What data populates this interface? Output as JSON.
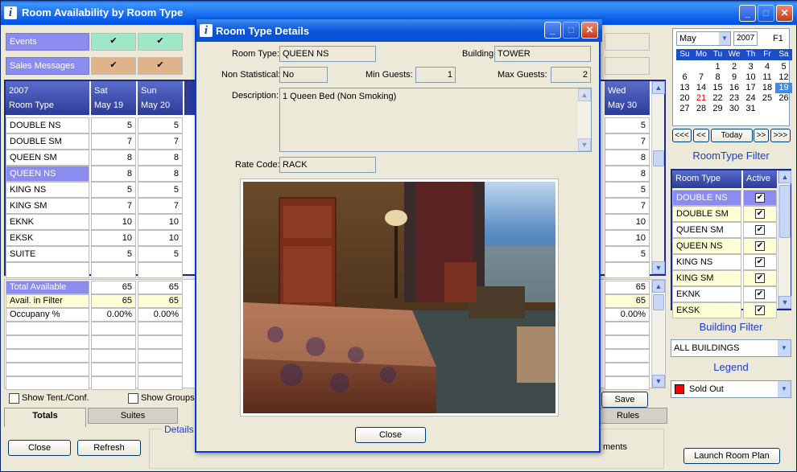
{
  "window": {
    "title": "Room Availability by Room Type"
  },
  "top_rows": {
    "events_label": "Events",
    "sales_label": "Sales Messages",
    "check": "✔"
  },
  "grid": {
    "year": "2007",
    "room_type_header": "Room Type",
    "days": [
      {
        "dow": "Sat",
        "date": "May 19"
      },
      {
        "dow": "Sun",
        "date": "May 20"
      },
      {
        "dow": "Wed",
        "date": "May 30"
      }
    ],
    "rows": [
      {
        "name": "DOUBLE NS",
        "sat": "5",
        "sun": "5",
        "wed": "5"
      },
      {
        "name": "DOUBLE SM",
        "sat": "7",
        "sun": "7",
        "wed": "7"
      },
      {
        "name": "QUEEN SM",
        "sat": "8",
        "sun": "8",
        "wed": "8"
      },
      {
        "name": "QUEEN NS",
        "sat": "8",
        "sun": "8",
        "wed": "8"
      },
      {
        "name": "KING NS",
        "sat": "5",
        "sun": "5",
        "wed": "5"
      },
      {
        "name": "KING SM",
        "sat": "7",
        "sun": "7",
        "wed": "7"
      },
      {
        "name": "EKNK",
        "sat": "10",
        "sun": "10",
        "wed": "10"
      },
      {
        "name": "EKSK",
        "sat": "10",
        "sun": "10",
        "wed": "10"
      },
      {
        "name": "SUITE",
        "sat": "5",
        "sun": "5",
        "wed": "5"
      }
    ]
  },
  "totals": {
    "rows": [
      {
        "name": "Total Available",
        "sat": "65",
        "sun": "65",
        "wed": "65"
      },
      {
        "name": "Avail. in Filter",
        "sat": "65",
        "sun": "65",
        "wed": "65"
      },
      {
        "name": "Occupany %",
        "sat": "0.00%",
        "sun": "0.00%",
        "wed": "0.00%"
      }
    ]
  },
  "bottom": {
    "show_tent": "Show Tent./Conf.",
    "show_groups": "Show Groups",
    "save": "Save",
    "tabs": [
      "Totals",
      "Suites",
      "Rules"
    ],
    "details_group": "Details",
    "comments_partial": "ments",
    "close": "Close",
    "refresh": "Refresh",
    "launch": "Launch Room Plan"
  },
  "calendar": {
    "month": "May",
    "year": "2007",
    "f1": "F1",
    "dow": [
      "Su",
      "Mo",
      "Tu",
      "We",
      "Th",
      "Fr",
      "Sa"
    ],
    "weeks": [
      [
        "",
        "",
        "1",
        "2",
        "3",
        "4",
        "5"
      ],
      [
        "6",
        "7",
        "8",
        "9",
        "10",
        "11",
        "12"
      ],
      [
        "13",
        "14",
        "15",
        "16",
        "17",
        "18",
        "19"
      ],
      [
        "20",
        "21",
        "22",
        "23",
        "24",
        "25",
        "26"
      ],
      [
        "27",
        "28",
        "29",
        "30",
        "31",
        "",
        ""
      ]
    ],
    "selected": "19",
    "red_day": "21",
    "nav": [
      "<<<",
      "<<",
      "Today",
      ">>",
      ">>>"
    ]
  },
  "roomtype_filter": {
    "title": "RoomType Filter",
    "col_room": "Room Type",
    "col_active": "Active",
    "items": [
      "DOUBLE NS",
      "DOUBLE SM",
      "QUEEN SM",
      "QUEEN NS",
      "KING NS",
      "KING SM",
      "EKNK",
      "EKSK"
    ]
  },
  "building_filter": {
    "title": "Building Filter",
    "value": "ALL BUILDINGS"
  },
  "legend": {
    "title": "Legend",
    "value": "Sold Out",
    "color": "#ff0000"
  },
  "dialog": {
    "title": "Room Type Details",
    "room_type_label": "Room Type:",
    "room_type": "QUEEN NS",
    "building_label": "Building:",
    "building": "TOWER",
    "non_stat_label": "Non Statistical:",
    "non_stat": "No",
    "min_guests_label": "Min Guests:",
    "min_guests": "1",
    "max_guests_label": "Max Guests:",
    "max_guests": "2",
    "description_label": "Description:",
    "description": "1 Queen Bed (Non Smoking)",
    "rate_code_label": "Rate Code:",
    "rate_code": "RACK",
    "close": "Close"
  }
}
